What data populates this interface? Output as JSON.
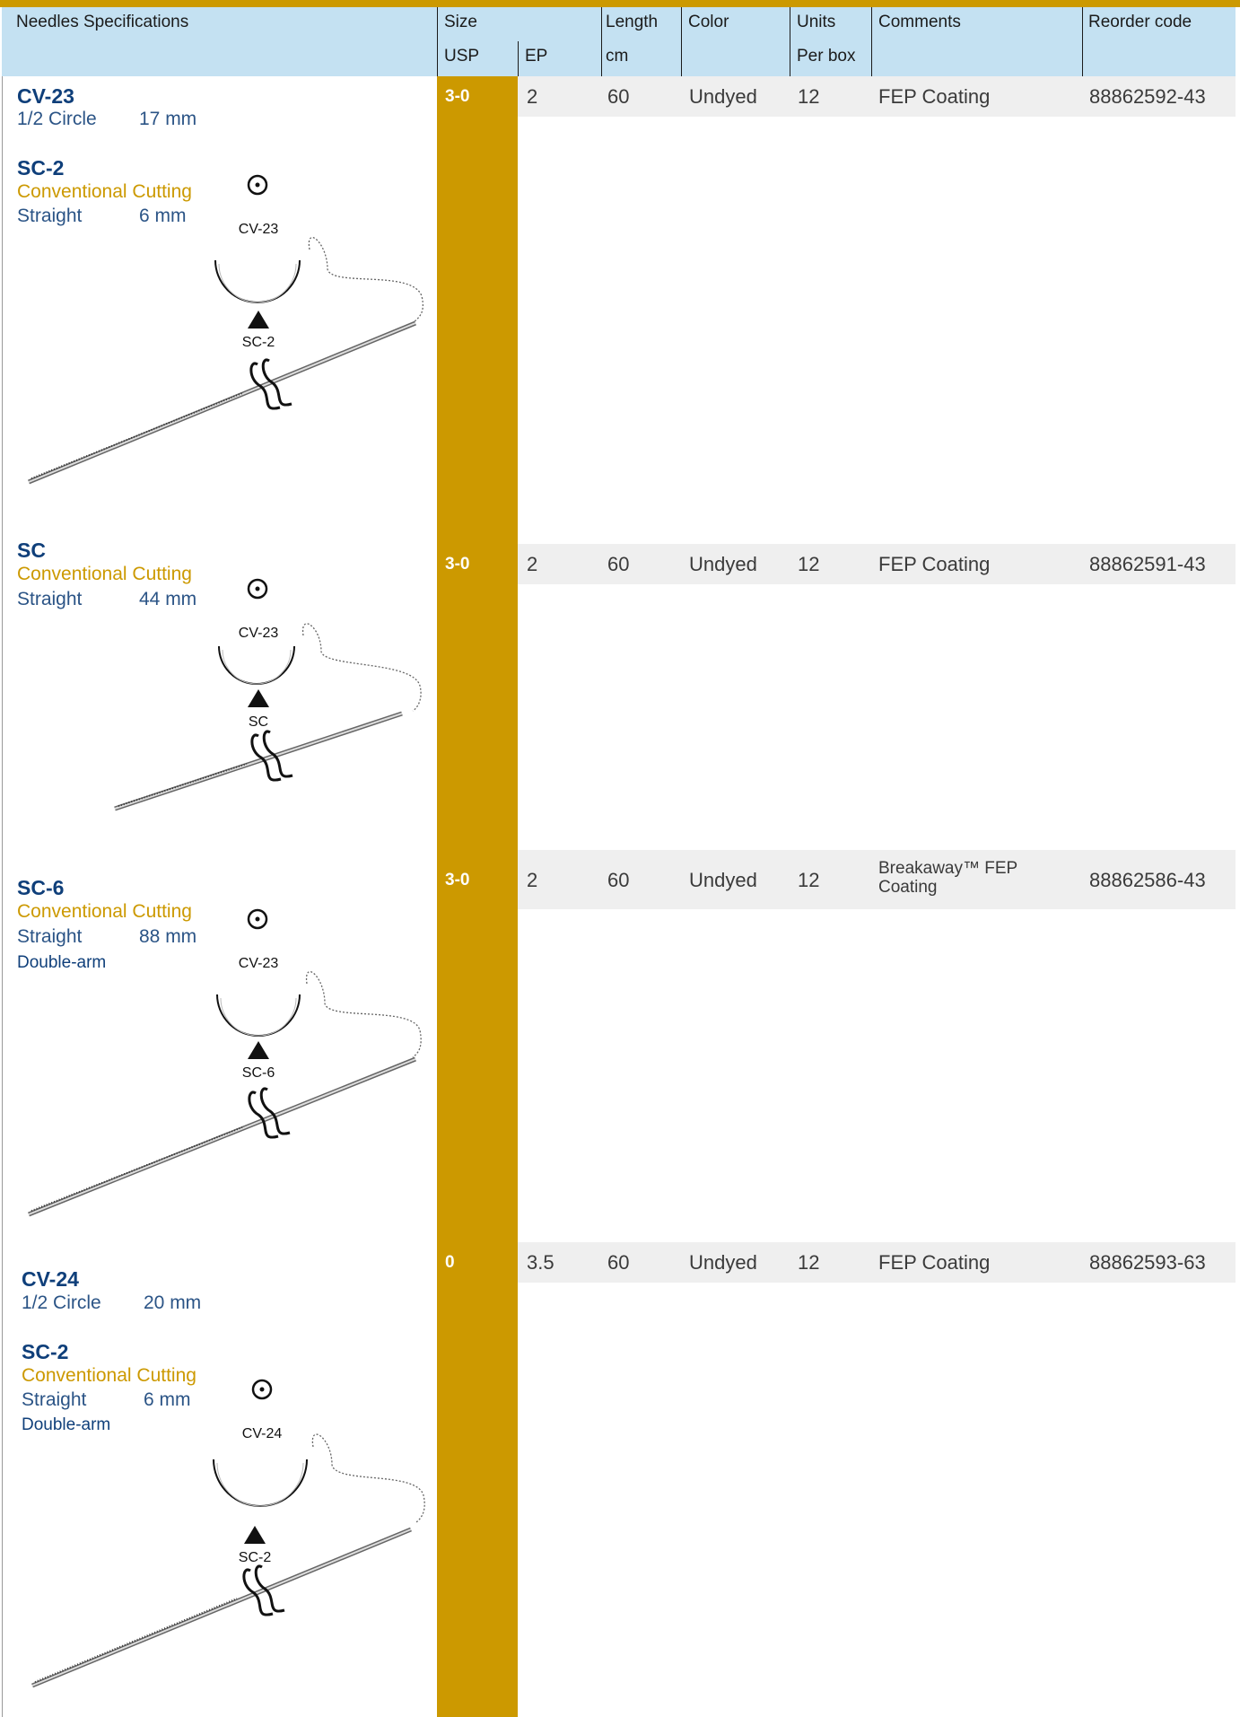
{
  "header": {
    "needles": "Needles Specifications",
    "size": "Size",
    "usp": "USP",
    "ep": "EP",
    "length": "Length",
    "cm": "cm",
    "color": "Color",
    "units": "Units",
    "per_box": "Per box",
    "comments": "Comments",
    "reorder": "Reorder code"
  },
  "rows": [
    {
      "needle1_code": "CV-23",
      "needle1_type": "1/2 Circle",
      "needle1_size": "17 mm",
      "needle2_code": "SC-2",
      "needle2_cutting": "Conventional Cutting",
      "needle2_type": "Straight",
      "needle2_size": "6 mm",
      "diagram_top": "CV-23",
      "diagram_bottom": "SC-2",
      "usp": "3-0",
      "ep": "2",
      "length": "60",
      "color": "Undyed",
      "units": "12",
      "comments": "FEP Coating",
      "reorder": "88862592-43"
    },
    {
      "needle2_code": "SC",
      "needle2_cutting": "Conventional Cutting",
      "needle2_type": "Straight",
      "needle2_size": "44 mm",
      "diagram_top": "CV-23",
      "diagram_bottom": "SC",
      "usp": "3-0",
      "ep": "2",
      "length": "60",
      "color": "Undyed",
      "units": "12",
      "comments": "FEP Coating",
      "reorder": "88862591-43"
    },
    {
      "needle2_code": "SC-6",
      "needle2_cutting": "Conventional Cutting",
      "needle2_type": "Straight",
      "needle2_size": "88 mm",
      "arm": "Double-arm",
      "diagram_top": "CV-23",
      "diagram_bottom": "SC-6",
      "usp": "3-0",
      "ep": "2",
      "length": "60",
      "color": "Undyed",
      "units": "12",
      "comments": "Breakaway™ FEP Coating",
      "reorder": "88862586-43"
    },
    {
      "needle1_code": "CV-24",
      "needle1_type": "1/2 Circle",
      "needle1_size": "20 mm",
      "needle2_code": "SC-2",
      "needle2_cutting": "Conventional Cutting",
      "needle2_type": "Straight",
      "needle2_size": "6 mm",
      "arm": "Double-arm",
      "diagram_top": "CV-24",
      "diagram_bottom": "SC-2",
      "usp": "0",
      "ep": "3.5",
      "length": "60",
      "color": "Undyed",
      "units": "12",
      "comments": "FEP Coating",
      "reorder": "88862593-63"
    }
  ]
}
